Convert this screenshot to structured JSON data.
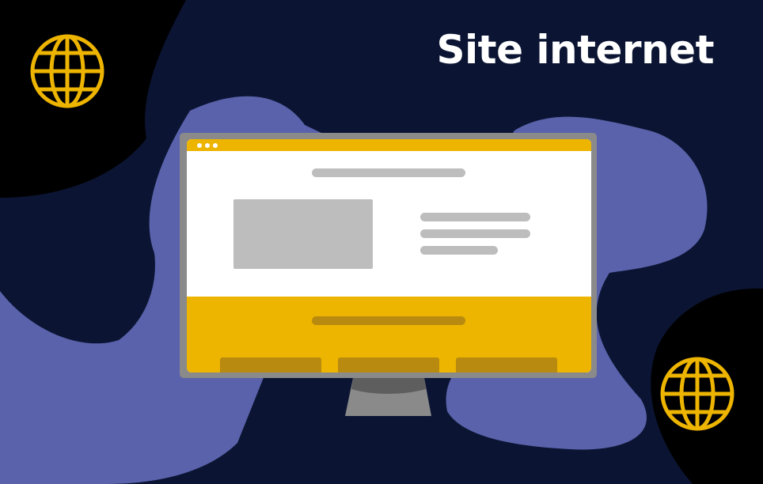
{
  "title": "Site internet",
  "colors": {
    "navy": "#0b1533",
    "black": "#000000",
    "periwinkle": "#5a62ab",
    "gold": "#edb400",
    "dark_gold": "#b88a0f",
    "monitor_frame": "#8a8a8a",
    "placeholder_gray": "#bdbdbd",
    "screen_white": "#ffffff",
    "title_text": "#ffffff"
  },
  "icons": {
    "top_left": "globe-icon",
    "bottom_right": "globe-icon"
  }
}
